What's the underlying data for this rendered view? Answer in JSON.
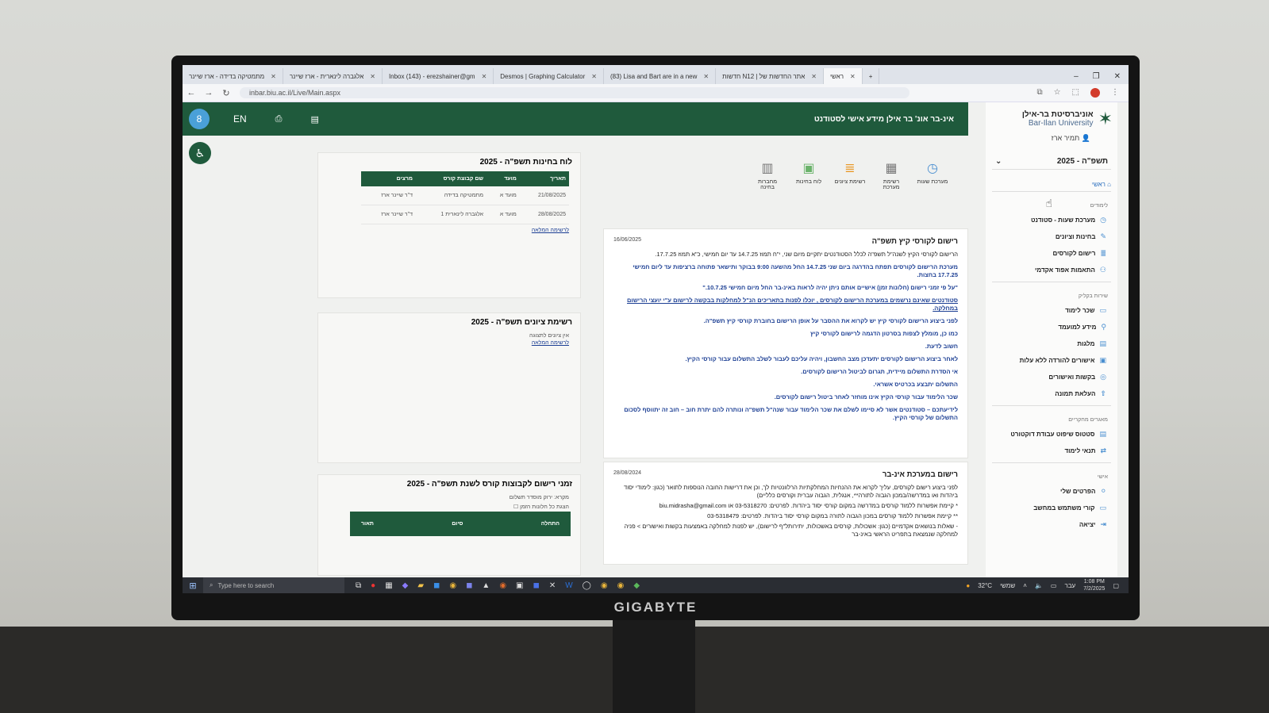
{
  "browser": {
    "tabs": [
      {
        "label": "מתמטיקה בדידה - ארז שיינר"
      },
      {
        "label": "אלגברה לינארית - ארז שיינר"
      },
      {
        "label": "Inbox (143) - erezshainer@gm"
      },
      {
        "label": "Desmos | Graphing Calculator"
      },
      {
        "label": "(83) Lisa and Bart are in a new"
      },
      {
        "label": "חדשות N12 | אתר החדשות של"
      },
      {
        "label": "ראשי"
      }
    ],
    "url": "inbar.biu.ac.il/Live/Main.aspx"
  },
  "header": {
    "user_initial": "8",
    "lang": "EN",
    "title": "אינ-בר אונ' בר אילן מידע אישי לסטודנט"
  },
  "sidebar": {
    "logo_heb": "אוניברסיטת בר-אילן",
    "logo_en": "Bar-Ilan University",
    "user": "תמיר ארז",
    "year": "תשפ\"ה - 2025",
    "home": "ראשי",
    "sections": [
      {
        "head": "לימודים",
        "items": [
          "מערכת שעות - סטודנט",
          "בחינות וציונים",
          "רישום לקורסים",
          "התאמות אפוד אקדמי"
        ]
      },
      {
        "head": "שירות בקליק",
        "items": [
          "שכר לימוד",
          "מידע למועמד",
          "מלגות",
          "אישורים להורדה ללא עלות",
          "בקשות ואישורים",
          "העלאת תמונה"
        ]
      },
      {
        "head": "מאגרים מחקריים",
        "items": [
          "סטטוס שיפוט עבודת דוקטורט",
          "תנאי לימוד"
        ]
      },
      {
        "head": "אישי",
        "items": [
          "הפרטים שלי",
          "קורי משתמש במחשב",
          "יציאה"
        ]
      }
    ]
  },
  "quick_icons": [
    {
      "label": "מערכת שעות"
    },
    {
      "label": "רשימת מערכת"
    },
    {
      "label": "רשימת ציונים"
    },
    {
      "label": "לוח בחינות"
    },
    {
      "label": "מחברות בחינה"
    }
  ],
  "news": {
    "title": "רישום לקורסי קיץ תשפ\"ה",
    "date": "16/06/2025",
    "paragraphs": [
      "הרישום לקורסי הקיץ לשנה\"ל תשפ\"ה לכלל הסטודנטים יתקיים מיום שני, י\"ח תמוז 14.7.25 עד יום חמישי, כ\"א תמוז 17.7.25.",
      "מערכת הרישום לקורסים תפתח בהדרגה ביום שני 14.7.25 החל מהשעה 9:00 בבוקר ותישאר פתוחה ברציפות עד ליום חמישי 17.7.25 בחצות.",
      "\"על פי זמני רישום (חלונות זמן) אישיים אותם ניתן יהיה לראות באינ-בר החל מיום חמישי 10.7.25.\"",
      "סטודנטים שאינם נרשמים במערכת הרישום לקורסים , יוכלו לפנות בתאריכים הנ\"ל למחלקות בבקשה לרישום ע\"י יועצי הרישום במחלקה.",
      "לפני ביצוע הרישום לקורסי קיץ יש לקרוא את ההסבר על אופן הרישום בחוברת קורסי קיץ תשפ\"ה.",
      "כמו כן, מומלץ לצפות בסרטון הדגמה לרישום לקורסי קיץ",
      "חשוב לדעת.",
      "לאחר ביצוע הרישום לקורסים יתעדכן מצב החשבון, ויהיה עליכם לעבור לשלב התשלום עבור קורסי הקיץ.",
      "אי הסדרת התשלום מיידית, תגרום לביטול הרישום לקורסים.",
      "התשלום יתבצע בכרטיס אשראי.",
      "שכר הלימוד עבור קורסי הקיץ אינו מוחזר לאחר ביטול רישום לקורסים.",
      "לידיעתכם – סטודנטים אשר לא סיימו לשלם את שכר הלימוד עבור שנה\"ל תשפ\"ה ונותרה להם יתרת חוב – חוב זה יתווסף לסכום התשלום של קורסי הקיץ."
    ]
  },
  "news2": {
    "title": "רישום במערכת אינ-בר",
    "date": "28/08/2024",
    "paragraphs": [
      "לפני ביצוע רישום לקורסים, עליך לקרוא את ההנחיות המחלקתיות הרלוונטיות לך, וכן את דרישות החובה הנוספות לתואר (כגון: לימודי יסוד ביהדות ואו במדרשה/במכון הגבוה לתורה**, אנגלית, הגבוה עברית וקורסים כלליים)",
      "* קיימת אפשרות ללמוד קורסים במדרשה במקום קורסי יסוד ביהדות. לפרטים: 03-5318270 או biu.midrasha@gmail.com",
      "** קיימת אפשרות ללמוד קורסים במכון הגבוה לתורה במקום קורסי יסוד ביהדות. לפרטים: 03-5318479",
      "- שאלות בנושאים אקדמיים (כגון: אשכולות, קורסים באשכולות, יתירותל\"ף לרישום), יש לפנות למחלקה באמצעות בקשות ואישורים > פניה למחלקה שנמצאת בתפריט הראשי באינ-בר"
    ]
  },
  "exams": {
    "title": "לוח בחינות תשפ\"ה - 2025",
    "columns": [
      "תאריך",
      "מועד",
      "שם קבוצת קורס",
      "מרצים"
    ],
    "rows": [
      [
        "21/08/2025",
        "מועד א",
        "מתמטיקה בדידה",
        "ד\"ר שיינר ארז"
      ],
      [
        "28/08/2025",
        "מועד א",
        "אלגברה לינארית 1",
        "ד\"ר שיינר ארז"
      ]
    ],
    "link": "לרשימה המלאה"
  },
  "grades": {
    "title": "רשימת ציונים תשפ\"ה - 2025",
    "empty": "אין ציונים לתצוגה",
    "link": "לרשימה המלאה"
  },
  "registration": {
    "title": "זמני רישום לקבוצות קורס לשנת תשפ\"ה - 2025",
    "note": "מקרא: ירוק מוסדר תשלום",
    "checkbox": "הצגת כל חלונות הזמן",
    "columns": [
      "התחלה",
      "סיום",
      "תאור"
    ]
  },
  "taskbar": {
    "search_placeholder": "Type here to search",
    "weather": "32°C",
    "weather_text": "שמשי",
    "lang": "עבר",
    "time": "1:08 PM",
    "date": "7/2/2025"
  },
  "monitor_brand": "GIGABYTE"
}
